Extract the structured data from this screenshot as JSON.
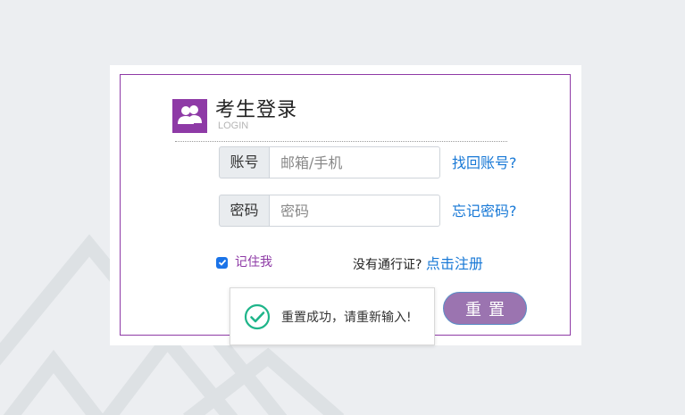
{
  "header": {
    "title": "考生登录",
    "subtitle": "LOGIN"
  },
  "account": {
    "label": "账号",
    "placeholder": "邮箱/手机",
    "value": "",
    "recover_link": "找回账号?"
  },
  "password": {
    "label": "密码",
    "placeholder": "密码",
    "value": "",
    "recover_link": "忘记密码?"
  },
  "remember": {
    "label": "记住我",
    "checked": true
  },
  "register": {
    "prompt": "没有通行证?",
    "link": "点击注册"
  },
  "buttons": {
    "login_label": "",
    "reset_label": "重置"
  },
  "toast": {
    "message": "重置成功，请重新输入!",
    "icon": "check-circle-icon"
  },
  "colors": {
    "accent": "#8e3aa6",
    "link": "#1778d6",
    "login_button": "#1fc28b",
    "reset_button": "#9b74b0",
    "toast_icon": "#1fb58a"
  }
}
